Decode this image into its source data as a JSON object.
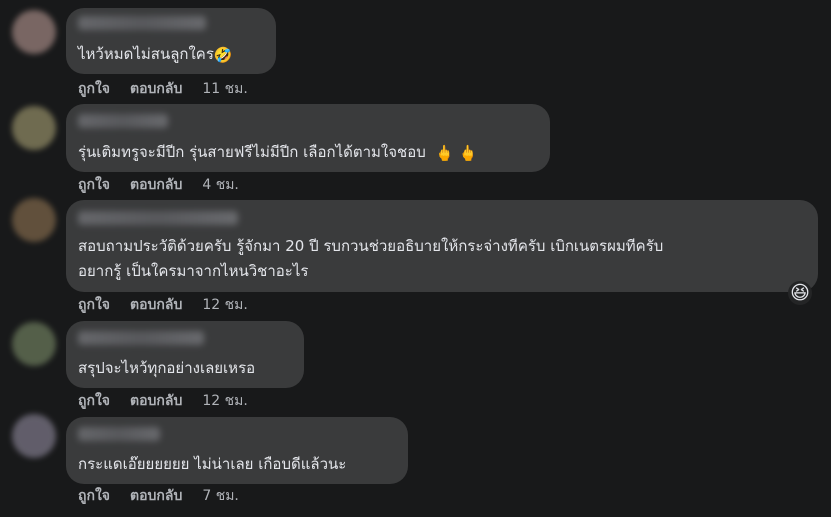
{
  "comments": [
    {
      "avatar_color": "#8a7470",
      "text": "ไหว้หมดไม่สนลูกใคร",
      "emoji": "🤣",
      "like": "ถูกใจ",
      "reply": "ตอบกลับ",
      "time": "11 ชม."
    },
    {
      "avatar_color": "#7f7a5a",
      "text": "รุ่นเติมทรูจะมีปีก รุ่นสายฟรีไม่มีปีก เลือกได้ตามใจชอบ",
      "emoji": "🖕 🖕",
      "like": "ถูกใจ",
      "reply": "ตอบกลับ",
      "time": "4 ชม."
    },
    {
      "avatar_color": "#6e5a42",
      "text_line1": "สอบถามประวัติด้วยครับ รู้จักมา 20 ปี รบกวนช่วยอธิบายให้กระจ่างทีครับ เบิกเนตรผมทีครับ",
      "text_line2": "อยากรู้ เป็นใครมาจากไหนวิชาอะไร",
      "reaction": "😆",
      "like": "ถูกใจ",
      "reply": "ตอบกลับ",
      "time": "12 ชม."
    },
    {
      "avatar_color": "#5f6c52",
      "text": "สรุปจะไหว้ทุกอย่างเลยเหรอ",
      "like": "ถูกใจ",
      "reply": "ตอบกลับ",
      "time": "12 ชม."
    },
    {
      "avatar_color": "#6e6a78",
      "text": "กระแดเอ๊ยยยยยย ไม่น่าเลย เกือบดีแล้วนะ",
      "like": "ถูกใจ",
      "reply": "ตอบกลับ",
      "time": "7 ชม."
    }
  ]
}
